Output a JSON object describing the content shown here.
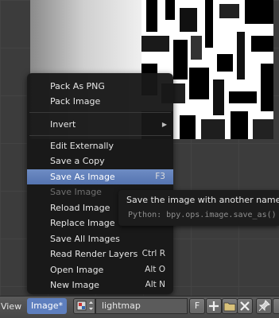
{
  "menu": {
    "items": [
      {
        "label": "Pack As PNG",
        "shortcut": "",
        "state": "normal"
      },
      {
        "label": "Pack Image",
        "shortcut": "",
        "state": "normal"
      },
      {
        "label": "Invert",
        "shortcut": "",
        "state": "submenu"
      },
      {
        "label": "Edit Externally",
        "shortcut": "",
        "state": "normal"
      },
      {
        "label": "Save a Copy",
        "shortcut": "",
        "state": "normal"
      },
      {
        "label": "Save As Image",
        "shortcut": "F3",
        "state": "active"
      },
      {
        "label": "Save Image",
        "shortcut": "",
        "state": "disabled"
      },
      {
        "label": "Reload Image",
        "shortcut": "",
        "state": "normal"
      },
      {
        "label": "Replace Image",
        "shortcut": "",
        "state": "normal"
      },
      {
        "label": "Save All Images",
        "shortcut": "",
        "state": "normal"
      },
      {
        "label": "Read Render Layers",
        "shortcut": "Ctrl R",
        "state": "normal"
      },
      {
        "label": "Open Image",
        "shortcut": "Alt O",
        "state": "normal"
      },
      {
        "label": "New Image",
        "shortcut": "Alt N",
        "state": "normal"
      }
    ]
  },
  "tooltip": {
    "text": "Save the image with another name and/",
    "python": "Python: bpy.ops.image.save_as()"
  },
  "header": {
    "view_label": "View",
    "image_menu_label": "Image*",
    "image_name": "lightmap",
    "fake_user_label": "F"
  },
  "icons": {
    "image_type": "image-browse-icon",
    "new": "plus-icon",
    "open": "folder-icon",
    "close": "close-icon",
    "pin": "pin-icon"
  },
  "colors": {
    "menu_bg": "#181818",
    "highlight": "#5e7fbe",
    "header_bg": "#4f4f4f"
  }
}
